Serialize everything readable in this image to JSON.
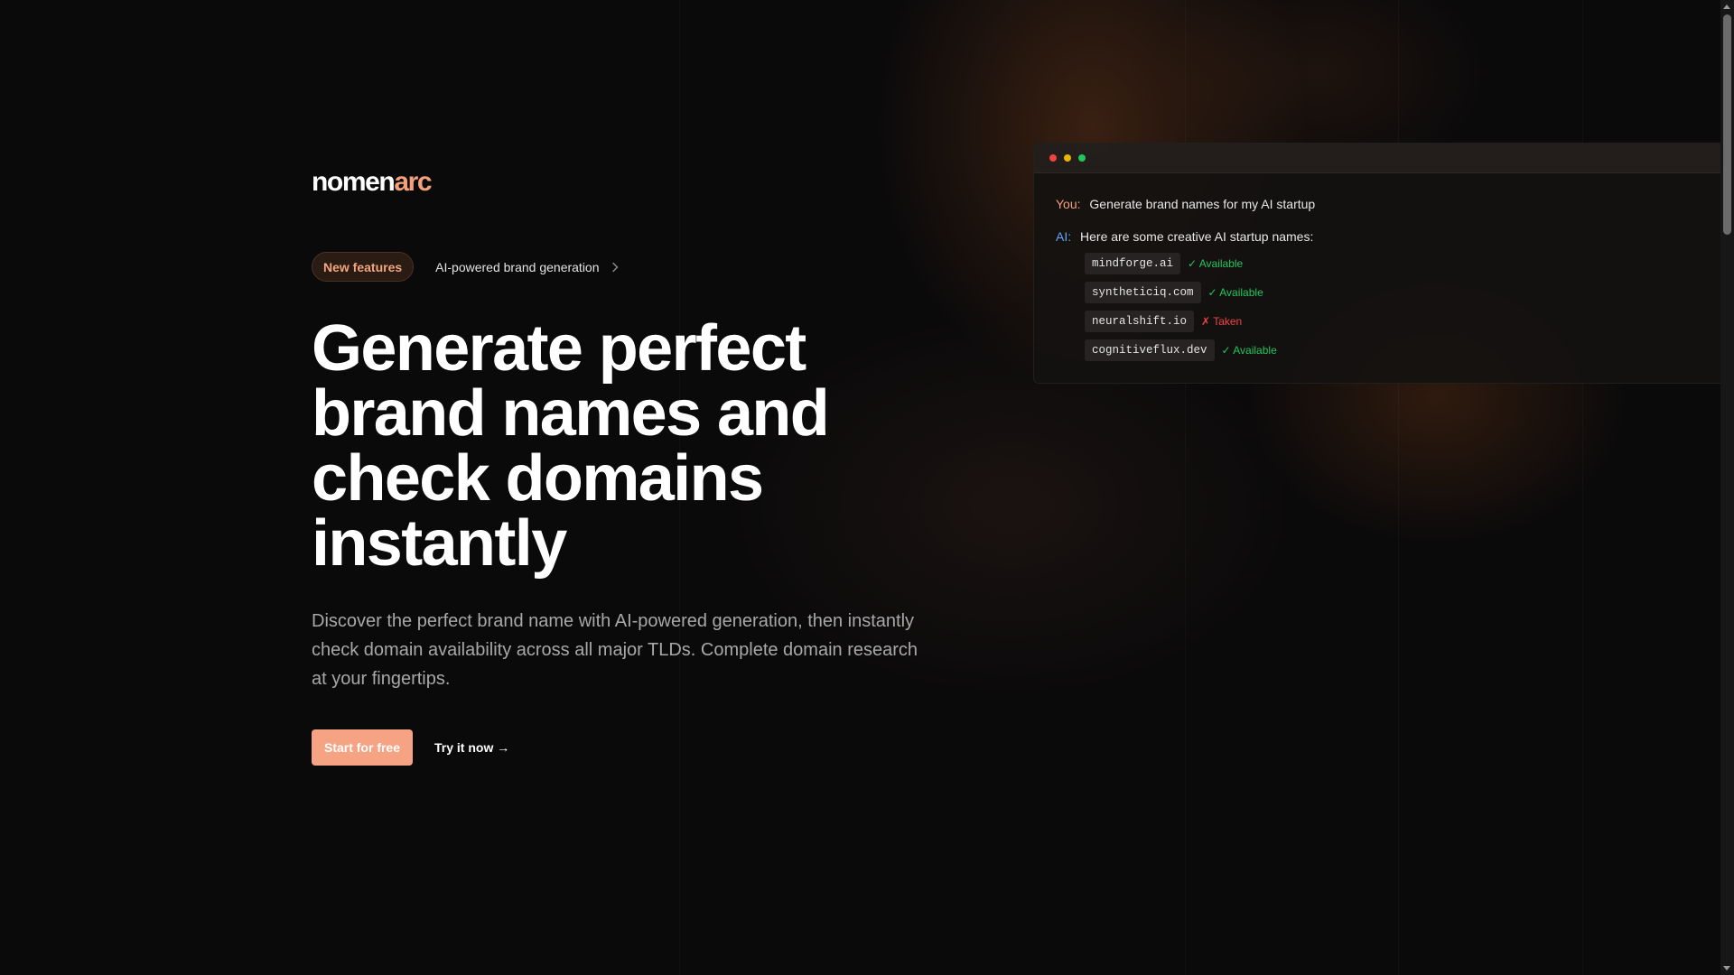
{
  "brand": {
    "part1": "nomen",
    "part2": "arc"
  },
  "announcement": {
    "badge": "New features",
    "text": "AI-powered brand generation"
  },
  "hero": {
    "headline": "Generate perfect brand names and check domains instantly",
    "subtext": "Discover the perfect brand name with AI-powered generation, then instantly check domain availability across all major TLDs. Complete domain research at your fingertips.",
    "cta_primary": "Start for free",
    "cta_secondary": "Try it now →"
  },
  "chat": {
    "user_label": "You:",
    "user_message": "Generate brand names for my AI startup",
    "ai_label": "AI:",
    "ai_message": "Here are some creative AI startup names:",
    "domains": [
      {
        "name": "mindforge.ai",
        "status": "✓ Available",
        "available": true
      },
      {
        "name": "syntheticiq.com",
        "status": "✓ Available",
        "available": true
      },
      {
        "name": "neuralshift.io",
        "status": "✗ Taken",
        "available": false
      },
      {
        "name": "cognitiveflux.dev",
        "status": "✓ Available",
        "available": true
      }
    ]
  },
  "colors": {
    "accent": "#f5a383",
    "background": "#0b0a0b",
    "available": "#22c55e",
    "taken": "#ef4444",
    "ai_label": "#60a5fa"
  }
}
